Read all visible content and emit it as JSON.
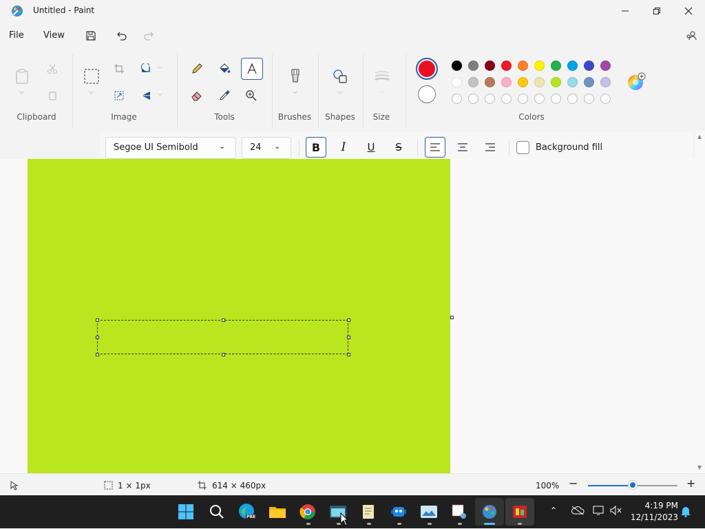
{
  "window": {
    "title": "Untitled - Paint"
  },
  "menu": {
    "file": "File",
    "view": "View"
  },
  "ribbon": {
    "groups": {
      "clipboard": "Clipboard",
      "image": "Image",
      "tools": "Tools",
      "brushes": "Brushes",
      "shapes": "Shapes",
      "size": "Size",
      "colors": "Colors"
    }
  },
  "colors": {
    "primary": "#e81123",
    "secondary": "#ffffff",
    "row1": [
      "#000000",
      "#7f7f7f",
      "#880015",
      "#ed1c24",
      "#ff7f27",
      "#fff200",
      "#22b14c",
      "#00a2e8",
      "#3f48cc",
      "#a349a4"
    ],
    "row2": [
      "#ffffff",
      "#c3c3c3",
      "#b97a57",
      "#ffaec9",
      "#ffc90e",
      "#efe4b0",
      "#b5e61d",
      "#99d9ea",
      "#7092be",
      "#c8bfe7"
    ],
    "row3_count": 10,
    "canvas_fill": "#b9e61e"
  },
  "text_toolbar": {
    "font_family": "Segoe UI Semibold",
    "font_size": "24",
    "bold": "B",
    "italic": "I",
    "underline": "U",
    "strike": "S",
    "background_fill": "Background fill"
  },
  "status": {
    "selection_size": "1 × 1px",
    "canvas_size": "614 × 460px",
    "zoom": "100%",
    "zoom_level": 0.5
  },
  "taskbar": {
    "time": "4:19 PM",
    "date": "12/11/2023",
    "edge_badge": "PRE"
  }
}
